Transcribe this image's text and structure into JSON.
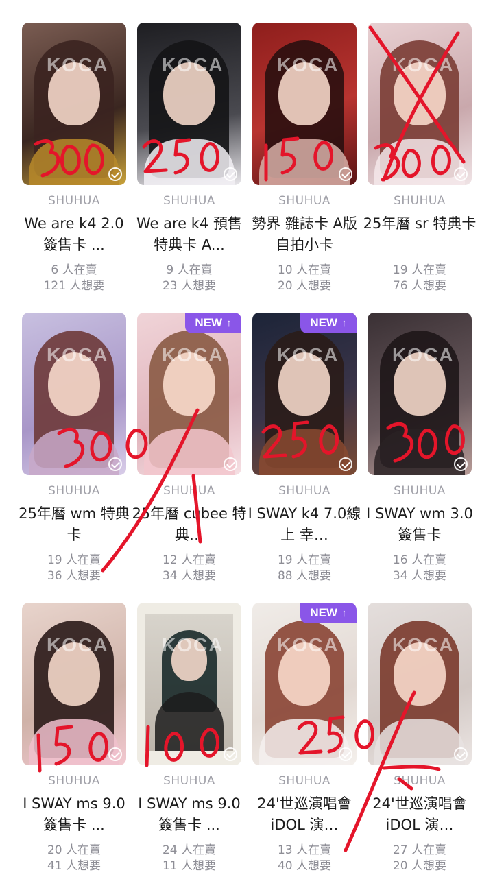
{
  "watermark": "KOCA",
  "colors": {
    "new_badge": "#8a56e8",
    "price_marks": "#e4152a"
  },
  "cards": [
    {
      "artist": "SHUHUA",
      "title": "We are k4 2.0 簽售卡 ...",
      "selling": "6 人在賣",
      "wanted": "121 人想要",
      "is_new": false,
      "handwritten_price": "300",
      "crossed_out": false
    },
    {
      "artist": "SHUHUA",
      "title": "We are k4 預售 特典卡 A...",
      "selling": "9 人在賣",
      "wanted": "23 人想要",
      "is_new": false,
      "handwritten_price": "250",
      "crossed_out": false
    },
    {
      "artist": "SHUHUA",
      "title": "勢界 雜誌卡 A版自拍小卡",
      "selling": "10 人在賣",
      "wanted": "20 人想要",
      "is_new": false,
      "handwritten_price": "150",
      "crossed_out": false
    },
    {
      "artist": "SHUHUA",
      "title": "25年曆 sr 特典卡",
      "selling": "19 人在賣",
      "wanted": "76 人想要",
      "is_new": false,
      "handwritten_price": "300",
      "crossed_out": true
    },
    {
      "artist": "SHUHUA",
      "title": "25年曆 wm 特典卡",
      "selling": "19 人在賣",
      "wanted": "36 人想要",
      "is_new": false,
      "handwritten_price": "300",
      "crossed_out": false
    },
    {
      "artist": "SHUHUA",
      "title": "25年曆 cubee 特典…",
      "selling": "12 人在賣",
      "wanted": "34 人想要",
      "is_new": true,
      "new_label": "NEW",
      "handwritten_price": "",
      "crossed_out": true
    },
    {
      "artist": "SHUHUA",
      "title": "I SWAY k4 7.0線上 幸…",
      "selling": "19 人在賣",
      "wanted": "88 人想要",
      "is_new": true,
      "new_label": "NEW",
      "handwritten_price": "250",
      "crossed_out": false
    },
    {
      "artist": "SHUHUA",
      "title": "I SWAY wm 3.0 簽售卡",
      "selling": "16 人在賣",
      "wanted": "34 人想要",
      "is_new": false,
      "handwritten_price": "300",
      "crossed_out": false
    },
    {
      "artist": "SHUHUA",
      "title": "I SWAY ms 9.0 簽售卡 ...",
      "selling": "20 人在賣",
      "wanted": "41 人想要",
      "is_new": false,
      "handwritten_price": "150",
      "crossed_out": false
    },
    {
      "artist": "SHUHUA",
      "title": "I SWAY ms 9.0 簽售卡 ...",
      "selling": "24 人在賣",
      "wanted": "11 人想要",
      "is_new": false,
      "handwritten_price": "100",
      "crossed_out": false
    },
    {
      "artist": "SHUHUA",
      "title": "24'世巡演唱會 iDOL 演…",
      "selling": "13 人在賣",
      "wanted": "40 人想要",
      "is_new": true,
      "new_label": "NEW",
      "handwritten_price": "250",
      "crossed_out": false
    },
    {
      "artist": "SHUHUA",
      "title": "24'世巡演唱會 iDOL 演…",
      "selling": "27 人在賣",
      "wanted": "20 人想要",
      "is_new": false,
      "handwritten_price": "",
      "crossed_out": true
    }
  ]
}
